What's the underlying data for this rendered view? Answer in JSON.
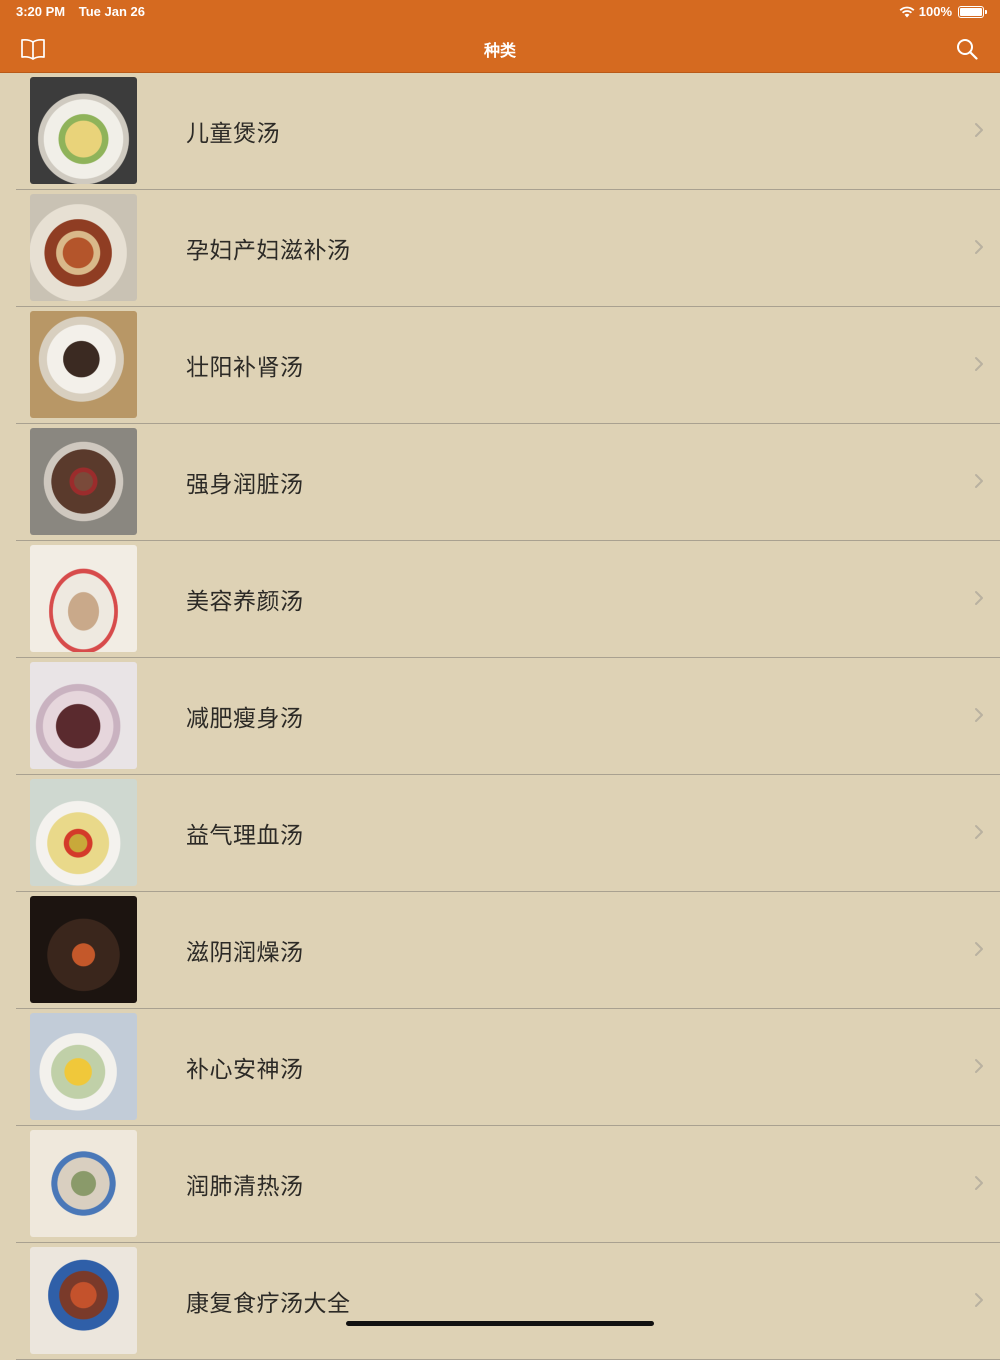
{
  "status_bar": {
    "time": "3:20 PM",
    "date": "Tue Jan 26",
    "battery": "100%"
  },
  "nav": {
    "title": "种类",
    "left_icon": "book-icon",
    "right_icon": "search-icon"
  },
  "categories": [
    {
      "label": "儿童煲汤",
      "thumb": "soup-thumbnail"
    },
    {
      "label": "孕妇产妇滋补汤",
      "thumb": "soup-thumbnail"
    },
    {
      "label": "壮阳补肾汤",
      "thumb": "soup-thumbnail"
    },
    {
      "label": "强身润脏汤",
      "thumb": "soup-thumbnail"
    },
    {
      "label": "美容养颜汤",
      "thumb": "soup-thumbnail"
    },
    {
      "label": "减肥瘦身汤",
      "thumb": "soup-thumbnail"
    },
    {
      "label": "益气理血汤",
      "thumb": "soup-thumbnail"
    },
    {
      "label": "滋阴润燥汤",
      "thumb": "soup-thumbnail"
    },
    {
      "label": "补心安神汤",
      "thumb": "soup-thumbnail"
    },
    {
      "label": "润肺清热汤",
      "thumb": "soup-thumbnail"
    },
    {
      "label": "康复食疗汤大全",
      "thumb": "soup-thumbnail"
    }
  ],
  "colors": {
    "accent": "#d56a20",
    "background": "#ded2b5",
    "text": "#2c2a26"
  }
}
